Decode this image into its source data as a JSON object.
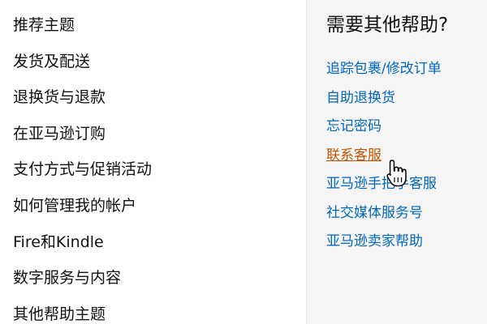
{
  "left_nav": {
    "items": [
      {
        "label": "推荐主题"
      },
      {
        "label": "发货及配送"
      },
      {
        "label": "退换货与退款"
      },
      {
        "label": "在亚马逊订购"
      },
      {
        "label": "支付方式与促销活动"
      },
      {
        "label": "如何管理我的帐户"
      },
      {
        "label": "Fire和Kindle"
      },
      {
        "label": "数字服务与内容"
      },
      {
        "label": "其他帮助主题"
      }
    ]
  },
  "help_panel": {
    "title": "需要其他帮助?",
    "links": [
      {
        "label": "追踪包裹/修改订单"
      },
      {
        "label": "自助退换货"
      },
      {
        "label": "忘记密码"
      },
      {
        "label": "联系客服",
        "state": "hover"
      },
      {
        "label": "亚马逊手把手客服"
      },
      {
        "label": "社交媒体服务号"
      },
      {
        "label": "亚马逊卖家帮助"
      }
    ]
  },
  "colors": {
    "link": "#0066c0",
    "link_hover": "#c45500",
    "panel_bg": "#f5f5f5",
    "text": "#111111"
  },
  "cursor": {
    "icon": "hand-pointer-icon"
  }
}
